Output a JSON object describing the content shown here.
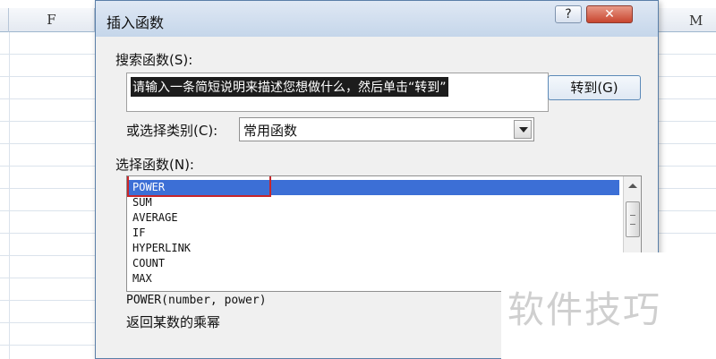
{
  "spreadsheet": {
    "column_headers": [
      "F",
      "M"
    ]
  },
  "dialog": {
    "title": "插入函数",
    "help_label": "?",
    "close_label": "✕",
    "search": {
      "label": "搜索函数(S):",
      "value": "请输入一条简短说明来描述您想做什么，然后单击“转到”"
    },
    "goto_label": "转到(G)",
    "category": {
      "label": "或选择类别(C):",
      "selected": "常用函数"
    },
    "function_list": {
      "label": "选择函数(N):",
      "items": [
        "POWER",
        "SUM",
        "AVERAGE",
        "IF",
        "HYPERLINK",
        "COUNT",
        "MAX"
      ],
      "selected_index": 0
    },
    "signature": "POWER(number, power)",
    "description": "返回某数的乘幂"
  },
  "watermark": "软件技巧",
  "icons": {
    "dropdown": "chevron-down-icon",
    "scroll_up": "chevron-up-icon"
  },
  "colors": {
    "selection": "#3c6fd6",
    "highlight_border": "#c8262a",
    "close_button": "#c8452f"
  }
}
